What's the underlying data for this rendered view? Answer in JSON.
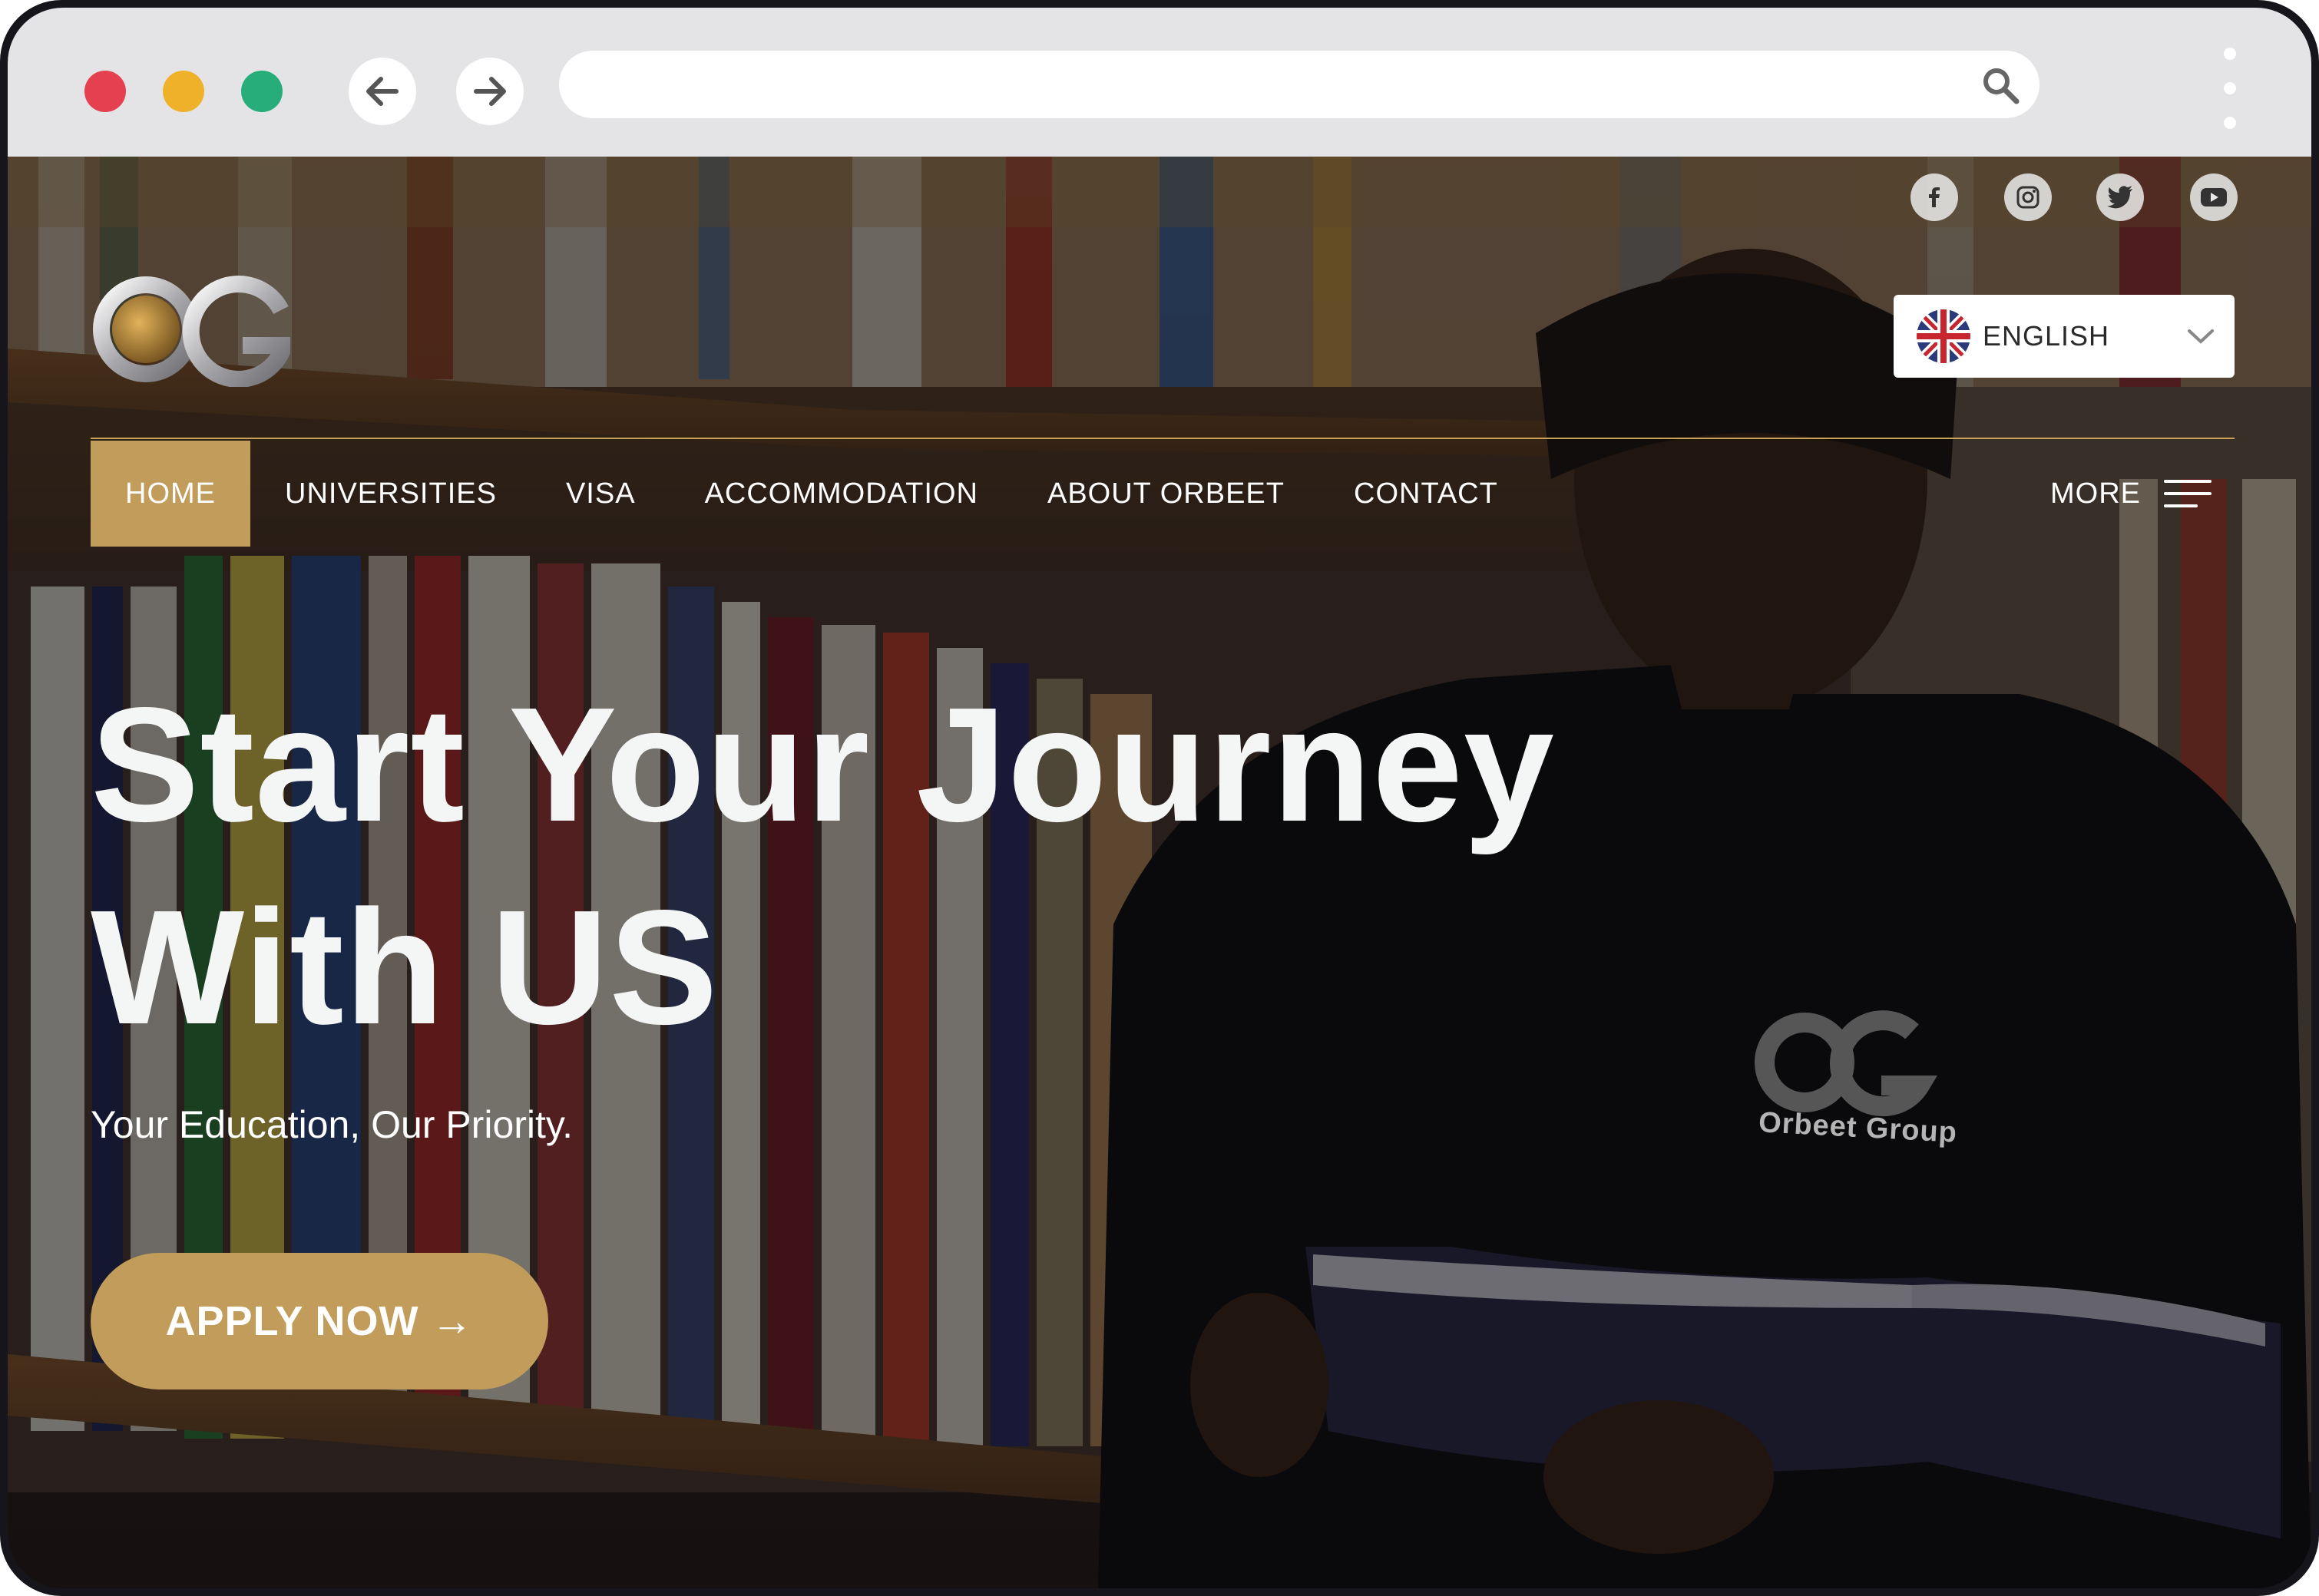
{
  "browser": {
    "address_value": ""
  },
  "social_links": [
    "facebook-icon",
    "instagram-icon",
    "twitter-icon",
    "youtube-icon"
  ],
  "language_selector": {
    "label": "ENGLISH",
    "flag": "uk-flag-icon"
  },
  "nav": {
    "items": [
      "HOME",
      "UNIVERSITIES",
      "VISA",
      "ACCOMMODATION",
      "ABOUT ORBEET",
      "CONTACT"
    ],
    "active": "HOME",
    "more_label": "MORE"
  },
  "hero": {
    "title_line1": "Start Your Journey",
    "title_line2": "With US",
    "subtitle": "Your Education, Our Priority.",
    "cta_label": "APPLY NOW →"
  },
  "photo": {
    "shirt_logo_caption": "Orbeet Group"
  },
  "colors": {
    "accent": "#c19c5a",
    "headline": "#f4f6f6"
  }
}
